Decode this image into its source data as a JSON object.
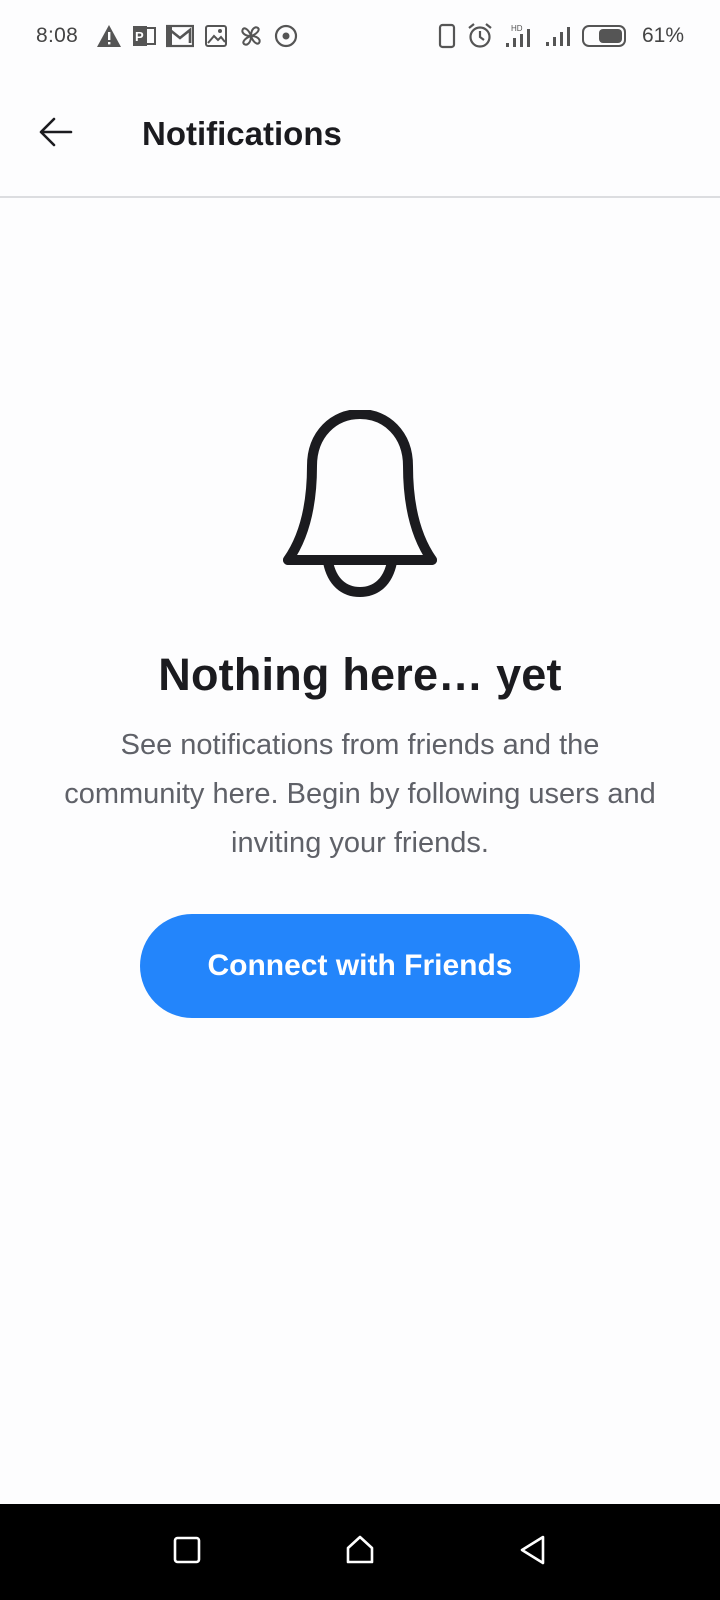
{
  "status_bar": {
    "time": "8:08",
    "battery_percent": "61%",
    "battery_level": 0.61,
    "icons_left": [
      "warning-icon",
      "publisher-icon",
      "mail-icon",
      "image-icon",
      "pinwheel-icon",
      "target-icon"
    ],
    "icons_right": [
      "phone-icon",
      "alarm-icon",
      "signal-hd-icon",
      "signal-icon",
      "battery-icon"
    ]
  },
  "header": {
    "title": "Notifications",
    "back_icon": "arrow-left-icon"
  },
  "empty_state": {
    "icon": "bell-icon",
    "title": "Nothing here… yet",
    "description": "See notifications from friends and the community here. Begin by following users and inviting your friends.",
    "button_label": "Connect with Friends"
  },
  "navigation": {
    "buttons": [
      "recents-icon",
      "home-icon",
      "back-icon"
    ]
  },
  "colors": {
    "accent": "#2385fb",
    "background": "#fdfdfe",
    "title_text": "#1b1b1f",
    "body_text": "#5f6168",
    "nav_bar": "#000000"
  }
}
